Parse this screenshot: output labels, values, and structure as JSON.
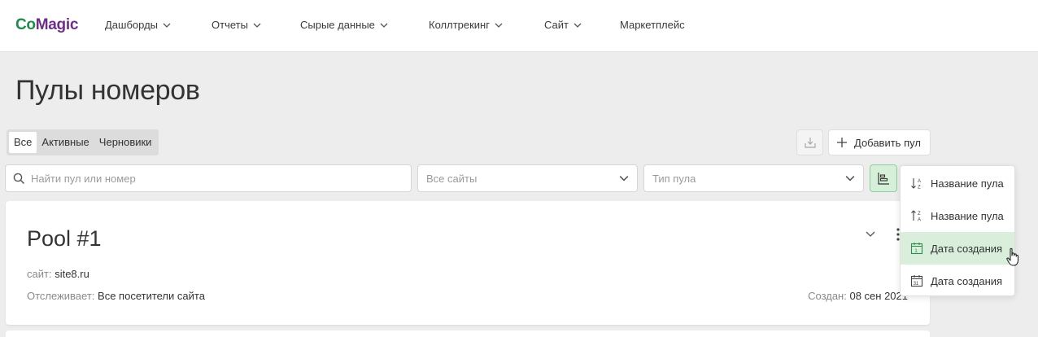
{
  "nav": {
    "logo_part1": "Co",
    "logo_part2": "Magic",
    "items": [
      {
        "label": "Дашборды"
      },
      {
        "label": "Отчеты"
      },
      {
        "label": "Сырые данные"
      },
      {
        "label": "Коллтрекинг"
      },
      {
        "label": "Сайт"
      },
      {
        "label": "Маркетплейс"
      }
    ]
  },
  "page": {
    "title": "Пулы номеров"
  },
  "tabs": [
    {
      "label": "Все",
      "active": true
    },
    {
      "label": "Активные",
      "active": false
    },
    {
      "label": "Черновики",
      "active": false
    }
  ],
  "toolbar": {
    "export_icon": "download-icon",
    "add_label": "Добавить пул"
  },
  "filters": {
    "search_placeholder": "Найти пул или номер",
    "sites_value": "Все сайты",
    "type_placeholder": "Тип пула",
    "sort_icon": "sort-icon"
  },
  "sort_menu": [
    {
      "label": "Название пула",
      "icon": "sort-alpha-asc-icon",
      "highlighted": false
    },
    {
      "label": "Название пула",
      "icon": "sort-alpha-desc-icon",
      "highlighted": false
    },
    {
      "label": "Дата создания",
      "icon": "calendar-asc-icon",
      "highlighted": true
    },
    {
      "label": "Дата создания",
      "icon": "calendar-desc-icon",
      "highlighted": false
    }
  ],
  "pools": [
    {
      "name": "Pool #1",
      "site_key": "сайт:",
      "site": "site8.ru",
      "tracks_key": "Отслеживает:",
      "tracks": "Все посетители сайта",
      "created_key": "Создан:",
      "created": "08 сен 2021"
    }
  ],
  "colors": {
    "brand_green": "#1f8a4c",
    "brand_purple": "#6e2f86",
    "highlight": "#d9efdc",
    "background": "#ededed"
  }
}
